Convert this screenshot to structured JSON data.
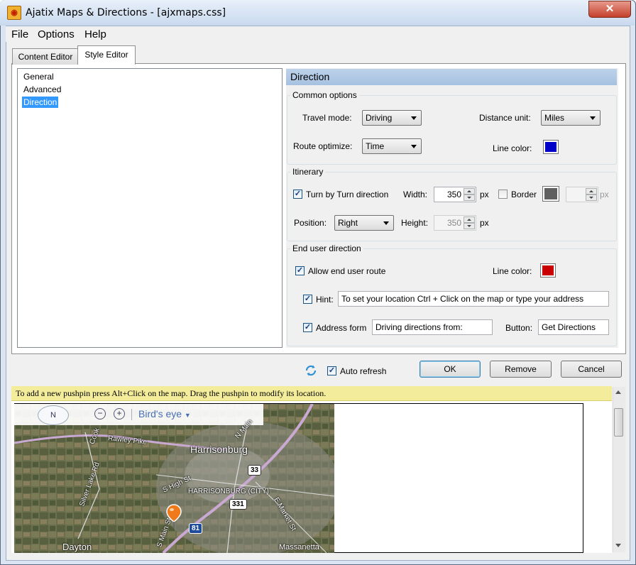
{
  "window": {
    "title": "Ajatix Maps & Directions - [ajxmaps.css]",
    "close_glyph": "✕"
  },
  "menu": [
    "File",
    "Options",
    "Help"
  ],
  "tabs": {
    "content_editor": "Content Editor",
    "style_editor": "Style Editor",
    "active": "Style Editor"
  },
  "tree": {
    "items": [
      "General",
      "Advanced",
      "Direction"
    ],
    "selected": "Direction"
  },
  "direction_panel": {
    "header": "Direction",
    "common": {
      "legend": "Common options",
      "travel_mode_label": "Travel mode:",
      "travel_mode_value": "Driving",
      "distance_unit_label": "Distance unit:",
      "distance_unit_value": "Miles",
      "route_optimize_label": "Route optimize:",
      "route_optimize_value": "Time",
      "line_color_label": "Line color:",
      "line_color": "#0000c8"
    },
    "itinerary": {
      "legend": "Itinerary",
      "turn_by_turn_label": "Turn by Turn direction",
      "turn_by_turn_checked": true,
      "width_label": "Width:",
      "width_value": "350",
      "width_unit": "px",
      "border_label": "Border",
      "border_checked": false,
      "border_color": "#606060",
      "border_unit": "px",
      "position_label": "Position:",
      "position_value": "Right",
      "height_label": "Height:",
      "height_value": "350",
      "height_unit": "px"
    },
    "end_user": {
      "legend": "End user direction",
      "allow_label": "Allow end user route",
      "allow_checked": true,
      "line_color_label": "Line color:",
      "line_color": "#c80000",
      "hint_label": "Hint:",
      "hint_checked": true,
      "hint_value": "To set your location Ctrl + Click on the map or type your address",
      "address_form_label": "Address form",
      "address_form_checked": true,
      "address_form_value": "Driving directions from:",
      "button_label": "Button:",
      "button_value": "Get Directions"
    }
  },
  "footer": {
    "refresh_icon": "refresh-icon",
    "auto_refresh_label": "Auto refresh",
    "auto_refresh_checked": true,
    "ok": "OK",
    "remove": "Remove",
    "cancel": "Cancel"
  },
  "preview": {
    "info": "To add a new pushpin press Alt+Click on the map. Drag the pushpin to modify its location.",
    "map_toolbar": {
      "compass_label": "N",
      "birds_eye": "Bird's eye"
    },
    "map_labels": {
      "city1": "Harrisonburg",
      "city2": "HARRISONBURG (CITY)",
      "city3": "Dayton",
      "city4": "Massanetta",
      "road1": "Rawley Pike",
      "road2": "Silver Lake Rd",
      "road3": "S High St",
      "road4": "Cook",
      "road5": "N Main",
      "road6": "S Main St",
      "road7": "E Market St",
      "shield1": "33",
      "shield2": "331",
      "shield3": "81"
    }
  }
}
